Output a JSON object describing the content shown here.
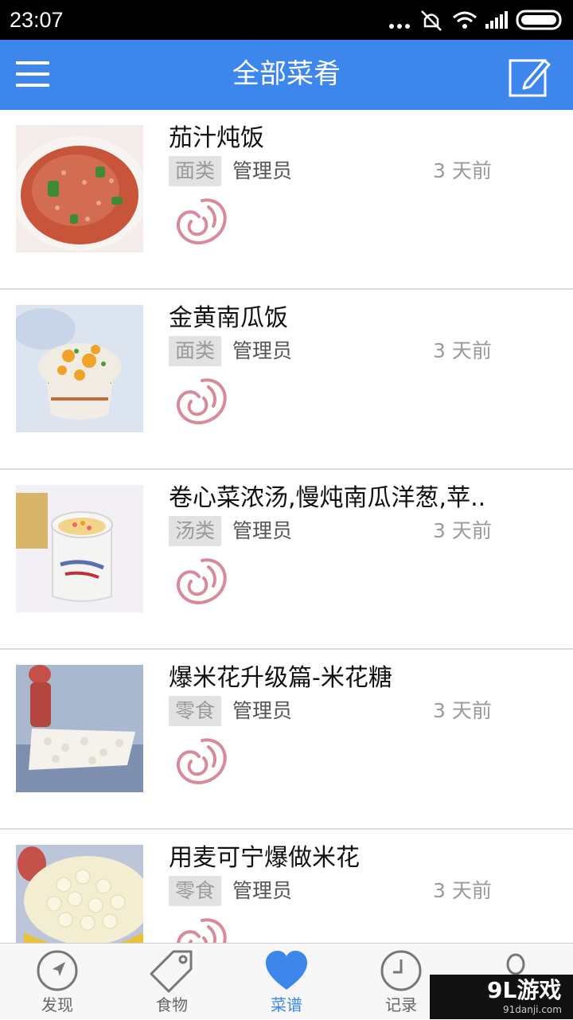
{
  "status_bar": {
    "time": "23:07"
  },
  "app_bar": {
    "title": "全部菜肴"
  },
  "recipes": [
    {
      "name": "茄汁炖饭",
      "category": "面类",
      "author": "管理员",
      "time": "3 天前"
    },
    {
      "name": "金黄南瓜饭",
      "category": "面类",
      "author": "管理员",
      "time": "3 天前"
    },
    {
      "name": "卷心菜浓汤,慢炖南瓜洋葱,苹..",
      "category": "汤类",
      "author": "管理员",
      "time": "3 天前"
    },
    {
      "name": "爆米花升级篇-米花糖",
      "category": "零食",
      "author": "管理员",
      "time": "3 天前"
    },
    {
      "name": "用麦可宁爆做米花",
      "category": "零食",
      "author": "管理员",
      "time": "3 天前"
    }
  ],
  "bottom_nav": [
    {
      "label": "发现",
      "icon": "compass-icon"
    },
    {
      "label": "食物",
      "icon": "tag-icon"
    },
    {
      "label": "菜谱",
      "icon": "heart-icon",
      "active": true
    },
    {
      "label": "记录",
      "icon": "clock-icon"
    },
    {
      "label": "",
      "icon": "user-icon"
    }
  ],
  "watermark": {
    "main": "9L游戏",
    "sub": "91danji.com"
  },
  "colors": {
    "accent": "#3d86ec",
    "tag_bg": "#e2e2e2",
    "logo": "#d88a9a"
  }
}
